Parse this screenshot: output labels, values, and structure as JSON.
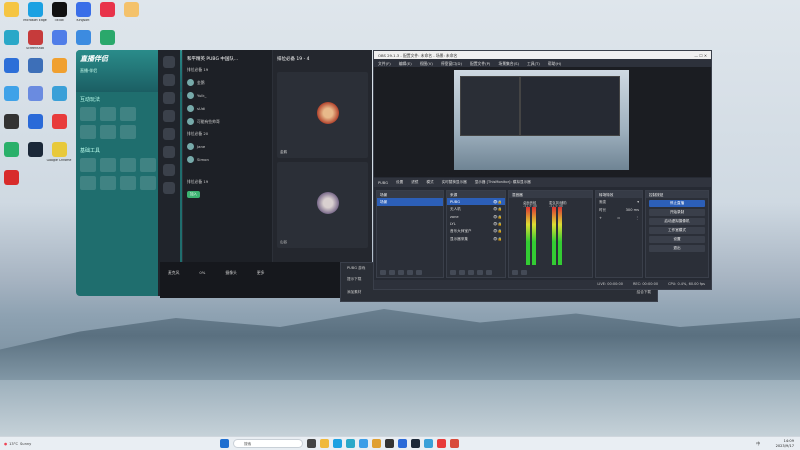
{
  "desktop": {
    "icons": [
      {
        "label": "",
        "color": "#f5c542"
      },
      {
        "label": "Microsoft Edge",
        "color": "#1ba1e2"
      },
      {
        "label": "TikTok",
        "color": "#111111"
      },
      {
        "label": "Kingsoft",
        "color": "#3a6ee8"
      },
      {
        "label": "",
        "color": "#e8334a"
      },
      {
        "label": "",
        "color": "#f4c26b"
      },
      {
        "label": "",
        "color": "#2aa8c8"
      },
      {
        "label": "Screenshot",
        "color": "#c63b3b"
      },
      {
        "label": "",
        "color": "#4f7de8"
      },
      {
        "label": "",
        "color": "#3c8be0"
      },
      {
        "label": "",
        "color": "#2aa86b"
      },
      {
        "label": "",
        "color": "#2d6fd8"
      },
      {
        "label": "",
        "color": "#3d6fb8"
      },
      {
        "label": "",
        "color": "#f0a030"
      },
      {
        "label": "",
        "color": "#3c9ee8"
      },
      {
        "label": "",
        "color": "#c94343"
      },
      {
        "label": "",
        "color": "#3fa2e8"
      },
      {
        "label": "",
        "color": "#6a8be0"
      },
      {
        "label": "",
        "color": "#3aa0d8"
      },
      {
        "label": "",
        "color": "#d23b3b"
      },
      {
        "label": "",
        "color": "#333333"
      },
      {
        "label": "",
        "color": "#2a6ad8"
      },
      {
        "label": "",
        "color": "#e83b3b"
      },
      {
        "label": "",
        "color": "#d84a3a"
      },
      {
        "label": "",
        "color": "#2ab06a"
      },
      {
        "label": "",
        "color": "#1b2838"
      },
      {
        "label": "Google Chrome",
        "color": "#e8c93b"
      },
      {
        "label": "",
        "color": "#2db84a"
      },
      {
        "label": "",
        "color": "#d82b2b"
      }
    ]
  },
  "live_app": {
    "logo": "直播伴侣",
    "sub": "直播·伴侣",
    "section1": "互动玩法",
    "section2": "基础工具",
    "avatar_label": "",
    "promo": "全新上线"
  },
  "chat_panel": {
    "title": "和平精英 PUBG 中国队...",
    "group1": "排位必备 19",
    "members": [
      "金鹅",
      "Yulk_",
      "sUdi",
      "可能有些帅哥",
      "Jane",
      "Simon"
    ],
    "group2": "排位必备 20",
    "group3": "排位必备 19",
    "join_button": "加入",
    "item_extra": "PUBG 中国队"
  },
  "game_panel": {
    "title": "排位必备 19 - 4",
    "slot1_name": "金鹅",
    "slot2_name": "山谷"
  },
  "bottom_bar": {
    "btn1": "麦克风",
    "btn2": "摄像头",
    "btn3": "更多",
    "volume": "0%"
  },
  "obs": {
    "title": "OBS 29.1.3 - 配置文件: 未命名 - 场景: 未命名",
    "menu": [
      "文件(F)",
      "编辑(E)",
      "视图(V)",
      "停靠窗口(D)",
      "配置文件(P)",
      "场景集合(S)",
      "工具(T)",
      "帮助(H)"
    ],
    "scene_bar": {
      "source": "PUBG",
      "btn1": "设置",
      "btn2": "滤镜",
      "mode": "模式",
      "mode_value": "实时替换显示器",
      "monitor": "显示器 [ThisMonitor]: 模拟显示器"
    },
    "docks": {
      "scenes": {
        "title": "场景",
        "items": [
          "场景"
        ]
      },
      "sources": {
        "title": "来源",
        "items": [
          "PUBG",
          "无人机",
          "zone",
          "LYL",
          "音乐大师宝户",
          "显示器采集"
        ]
      },
      "mixer": {
        "title": "混音器",
        "ch1": "桌面音频",
        "ch1_db": "-51.9 dB",
        "ch2": "麦克风/辅助",
        "ch2_db": "-51.9 dB"
      },
      "transitions": {
        "title": "转场特效",
        "type": "渐变",
        "duration_label": "时长",
        "duration_value": "300 ms"
      },
      "controls": {
        "title": "控制按钮",
        "buttons": [
          "停止直播",
          "开始录制",
          "启动虚拟摄像机",
          "工作室模式",
          "设置",
          "退出"
        ]
      }
    },
    "status": {
      "live": "LIVE: 00:00:00",
      "rec": "REC: 00:00:00",
      "cpu": "CPU: 0.4%, 60.00 fps"
    }
  },
  "small_win": {
    "item1": "PUBG 游戏",
    "item2": "提示下载",
    "left": "添加素材",
    "right": "结合下载"
  },
  "taskbar": {
    "weather_temp": "13°C",
    "weather_desc": "Sunny",
    "search_placeholder": "搜索",
    "time": "14:09",
    "date": "2023/9/17",
    "lang": "中"
  }
}
